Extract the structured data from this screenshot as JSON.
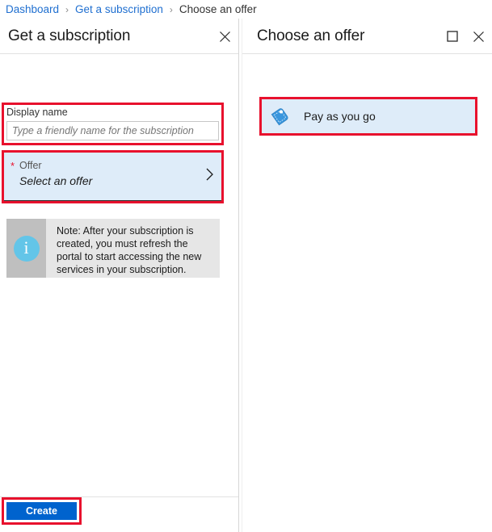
{
  "breadcrumb": {
    "items": [
      {
        "label": "Dashboard",
        "current": false
      },
      {
        "label": "Get a subscription",
        "current": false
      },
      {
        "label": "Choose an offer",
        "current": true
      }
    ],
    "separator": "›"
  },
  "left_panel": {
    "title": "Get a subscription",
    "close_icon": "close-icon",
    "display_name": {
      "label": "Display name",
      "value": "",
      "placeholder": "Type a friendly name for the subscription"
    },
    "offer": {
      "required_marker": "*",
      "label": "Offer",
      "value": "Select an offer",
      "chevron_icon": "chevron-right-icon"
    },
    "note": {
      "icon": "info-icon",
      "icon_glyph": "i",
      "text": "Note: After your subscription is created, you must refresh the portal to start accessing the new services in your subscription."
    },
    "create_label": "Create"
  },
  "right_panel": {
    "title": "Choose an offer",
    "maximize_icon": "maximize-icon",
    "close_icon": "close-icon",
    "offers": [
      {
        "label": "Pay as you go",
        "icon": "price-tag-icon"
      }
    ]
  },
  "colors": {
    "annotation": "#e8112d",
    "link": "#1f6fd0",
    "primary_button": "#0063ce",
    "selected_row": "#deecf9",
    "info_icon": "#63c5e8",
    "note_bg": "#e6e6e6",
    "note_icon_bg": "#bfbfbf"
  }
}
